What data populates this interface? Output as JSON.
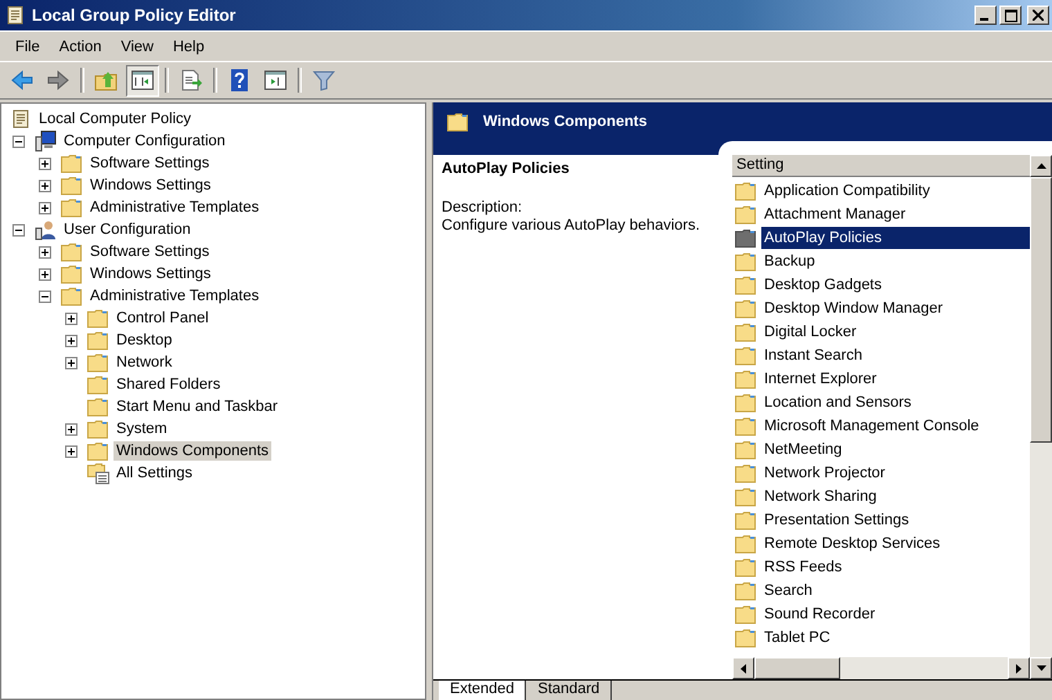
{
  "window": {
    "title": "Local Group Policy Editor"
  },
  "menu": [
    "File",
    "Action",
    "View",
    "Help"
  ],
  "toolbar": [
    {
      "kind": "back",
      "pressed": false
    },
    {
      "kind": "forward",
      "pressed": false
    },
    {
      "kind": "sep"
    },
    {
      "kind": "up",
      "pressed": false
    },
    {
      "kind": "tree",
      "pressed": true
    },
    {
      "kind": "sep"
    },
    {
      "kind": "export",
      "pressed": false
    },
    {
      "kind": "sep"
    },
    {
      "kind": "help",
      "pressed": false
    },
    {
      "kind": "action",
      "pressed": false
    },
    {
      "kind": "sep"
    },
    {
      "kind": "filter",
      "pressed": false
    }
  ],
  "tree": [
    {
      "label": "Local Computer Policy",
      "kind": "policy",
      "selected": false,
      "children": [
        {
          "label": "Computer Configuration",
          "kind": "computer",
          "expanded": true,
          "selected": false,
          "children": [
            {
              "label": "Software Settings",
              "kind": "folder",
              "expanded": false,
              "selected": false
            },
            {
              "label": "Windows Settings",
              "kind": "folder",
              "expanded": false,
              "selected": false
            },
            {
              "label": "Administrative Templates",
              "kind": "folder",
              "expanded": false,
              "selected": false
            }
          ]
        },
        {
          "label": "User Configuration",
          "kind": "user",
          "expanded": true,
          "selected": false,
          "children": [
            {
              "label": "Software Settings",
              "kind": "folder",
              "expanded": false,
              "selected": false
            },
            {
              "label": "Windows Settings",
              "kind": "folder",
              "expanded": false,
              "selected": false
            },
            {
              "label": "Administrative Templates",
              "kind": "folder",
              "expanded": true,
              "selected": false,
              "children": [
                {
                  "label": "Control Panel",
                  "kind": "folder",
                  "expanded": false,
                  "selected": false
                },
                {
                  "label": "Desktop",
                  "kind": "folder",
                  "expanded": false,
                  "selected": false
                },
                {
                  "label": "Network",
                  "kind": "folder",
                  "expanded": false,
                  "selected": false
                },
                {
                  "label": "Shared Folders",
                  "kind": "folder",
                  "selected": false
                },
                {
                  "label": "Start Menu and Taskbar",
                  "kind": "folder",
                  "selected": false
                },
                {
                  "label": "System",
                  "kind": "folder",
                  "expanded": false,
                  "selected": false
                },
                {
                  "label": "Windows Components",
                  "kind": "folder",
                  "expanded": false,
                  "selected": true
                },
                {
                  "label": "All Settings",
                  "kind": "all-settings",
                  "selected": false
                }
              ]
            }
          ]
        }
      ]
    }
  ],
  "details": {
    "header": "Windows Components",
    "title": "AutoPlay Policies",
    "description_label": "Description:",
    "description": "Configure various AutoPlay behaviors."
  },
  "list": {
    "column": "Setting",
    "items": [
      {
        "label": "Application Compatibility",
        "selected": false
      },
      {
        "label": "Attachment Manager",
        "selected": false
      },
      {
        "label": "AutoPlay Policies",
        "selected": true
      },
      {
        "label": "Backup",
        "selected": false
      },
      {
        "label": "Desktop Gadgets",
        "selected": false
      },
      {
        "label": "Desktop Window Manager",
        "selected": false
      },
      {
        "label": "Digital Locker",
        "selected": false
      },
      {
        "label": "Instant Search",
        "selected": false
      },
      {
        "label": "Internet Explorer",
        "selected": false
      },
      {
        "label": "Location and Sensors",
        "selected": false
      },
      {
        "label": "Microsoft Management Console",
        "selected": false
      },
      {
        "label": "NetMeeting",
        "selected": false
      },
      {
        "label": "Network Projector",
        "selected": false
      },
      {
        "label": "Network Sharing",
        "selected": false
      },
      {
        "label": "Presentation Settings",
        "selected": false
      },
      {
        "label": "Remote Desktop Services",
        "selected": false
      },
      {
        "label": "RSS Feeds",
        "selected": false
      },
      {
        "label": "Search",
        "selected": false
      },
      {
        "label": "Sound Recorder",
        "selected": false
      },
      {
        "label": "Tablet PC",
        "selected": false
      }
    ]
  },
  "view_tabs": [
    {
      "label": "Extended",
      "selected": true
    },
    {
      "label": "Standard",
      "selected": false
    }
  ]
}
